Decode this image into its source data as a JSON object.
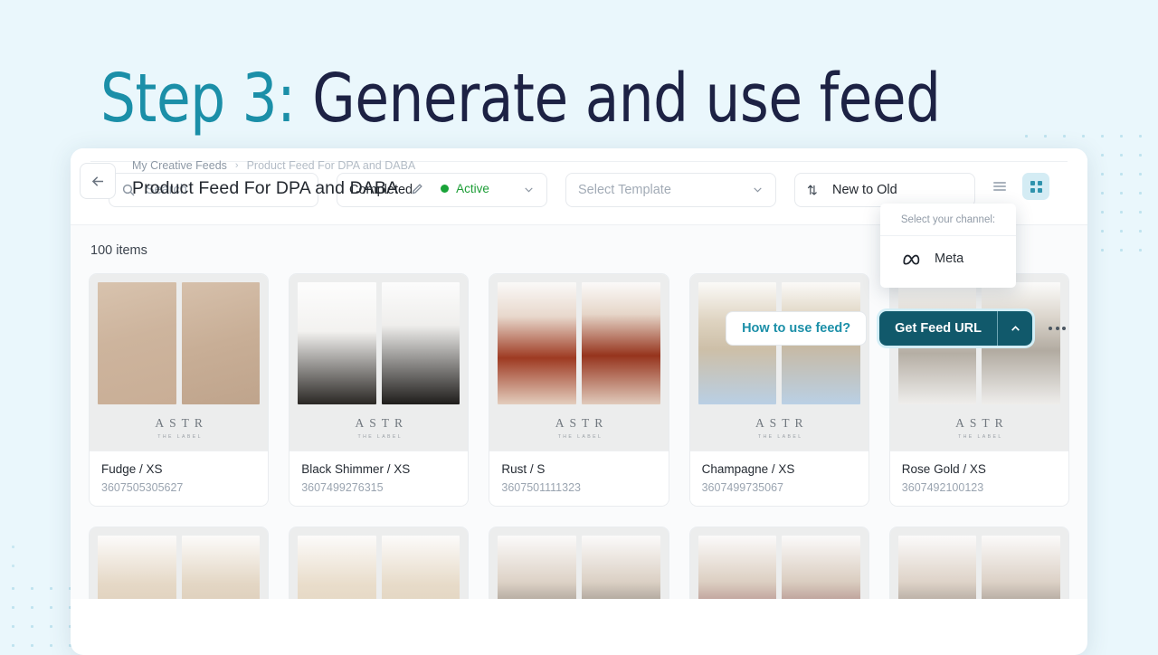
{
  "heading": {
    "accent": "Step 3:",
    "rest": " Generate and use feed"
  },
  "breadcrumb": {
    "parent": "My Creative Feeds",
    "separator": "›",
    "current": "Product Feed For DPA and DABA"
  },
  "header": {
    "title": "Product Feed For DPA and DABA",
    "status_label": "Active",
    "status_color": "#19a338",
    "how_to_label": "How to use feed?",
    "get_feed_label": "Get Feed URL",
    "back_icon": "arrow-left-icon",
    "edit_icon": "pencil-icon",
    "more_icon": "kebab-menu-icon"
  },
  "channel_menu": {
    "heading": "Select your channel:",
    "items": [
      {
        "label": "Meta",
        "icon": "meta-logo-icon"
      }
    ]
  },
  "filters": {
    "search_placeholder": "Search",
    "status_value": "Completed",
    "template_placeholder": "Select Template",
    "sort_value": "New to Old",
    "view_list_label": "list-view",
    "view_grid_label": "grid-view",
    "active_view": "grid"
  },
  "content": {
    "item_count": "100 items",
    "brand": {
      "name": "ASTR",
      "sub": "THE LABEL"
    },
    "products": [
      {
        "title": "Fudge / XS",
        "sku": "3607505305627"
      },
      {
        "title": "Black Shimmer / XS",
        "sku": "3607499276315"
      },
      {
        "title": "Rust / S",
        "sku": "3607501111323"
      },
      {
        "title": "Champagne / XS",
        "sku": "3607499735067"
      },
      {
        "title": "Rose Gold / XS",
        "sku": "3607492100123"
      }
    ],
    "products_row2": [
      {
        "title": "",
        "sku": ""
      },
      {
        "title": "",
        "sku": ""
      },
      {
        "title": "",
        "sku": ""
      },
      {
        "title": "",
        "sku": ""
      },
      {
        "title": "",
        "sku": ""
      }
    ]
  },
  "colors": {
    "page_bg": "#eaf7fc",
    "accent_teal": "#1b8fa8",
    "button_dark": "#11596b",
    "heading_dark": "#1d2244",
    "dot_pattern": "#bfe3ef"
  }
}
